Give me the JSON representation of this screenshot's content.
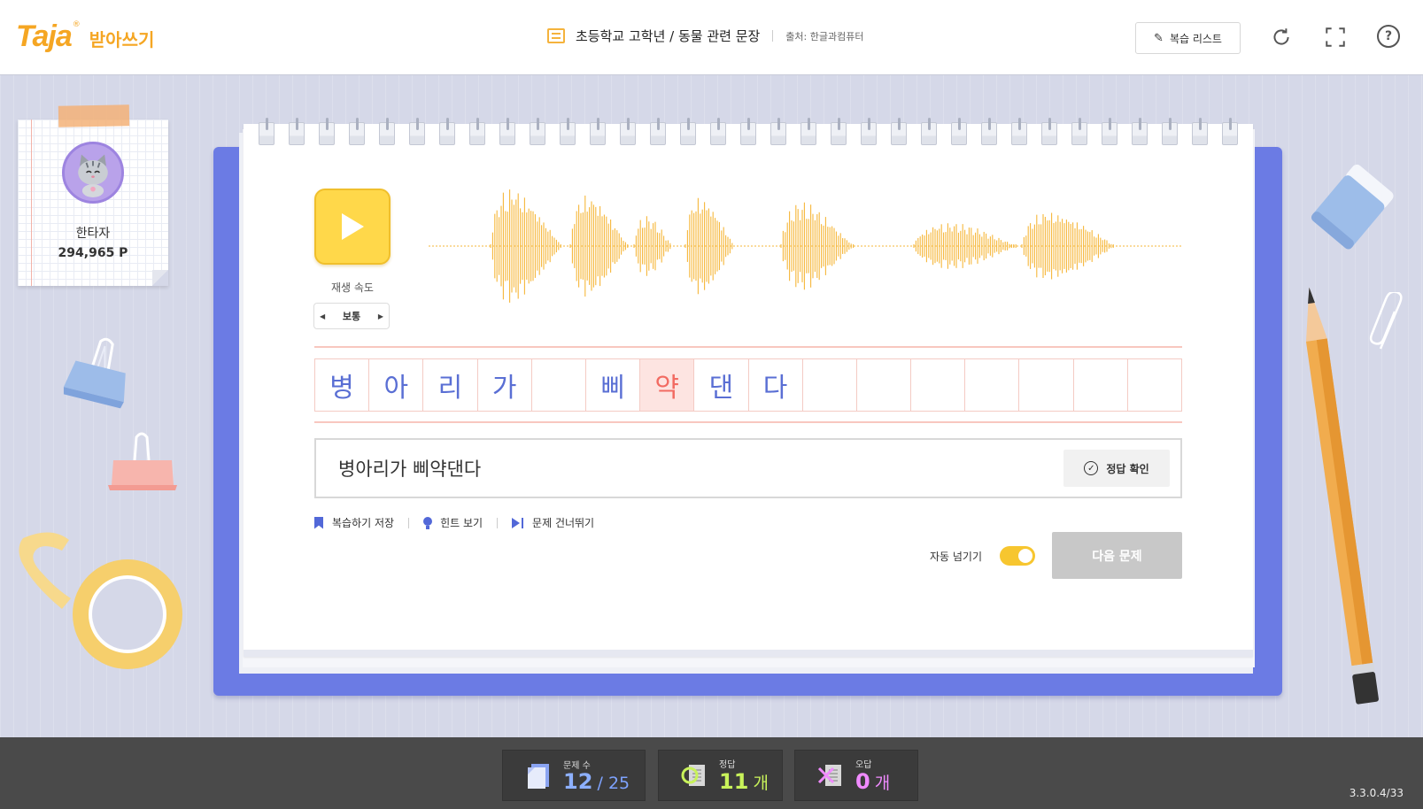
{
  "header": {
    "logo_text": "Taja",
    "logo_reg": "®",
    "logo_subtitle": "받아쓰기",
    "course_title": "초등학교 고학년 / 동물 관련 문장",
    "source": "출처: 한글과컴퓨터",
    "review_list_label": "복습 리스트",
    "help_symbol": "?"
  },
  "profile": {
    "name": "한타자",
    "points": "294,965 P"
  },
  "player": {
    "speed_label": "재생 속도",
    "speed_value": "보통",
    "speed_prev": "◀",
    "speed_next": "▶"
  },
  "answer_cells": [
    "병",
    "아",
    "리",
    "가",
    "",
    "삐",
    "약",
    "댄",
    "다",
    "",
    "",
    "",
    "",
    "",
    "",
    ""
  ],
  "answer_active_index": 6,
  "answer": {
    "typed_text": "병아리가 삐약댄다",
    "check_label": "정답 확인",
    "check_symbol": "✓"
  },
  "tools": {
    "save_review": "복습하기 저장",
    "hint": "힌트 보기",
    "skip": "문제 건너뛰기"
  },
  "controls": {
    "auto_next_label": "자동 넘기기",
    "auto_next_on": true,
    "next_label": "다음 문제"
  },
  "stats": {
    "questions_label": "문제 수",
    "questions_current": "12",
    "questions_total": "/ 25",
    "correct_label": "정답",
    "correct_count": "11",
    "correct_unit": "개",
    "wrong_label": "오답",
    "wrong_count": "0",
    "wrong_unit": "개"
  },
  "version": "3.3.0.4/33",
  "colors": {
    "brand": "#f5a623",
    "accent_blue": "#5a6fd4",
    "active_char": "#f26b62",
    "waveform": "#f5b73a",
    "board": "#6b7be4",
    "toggle_on": "#f7c62f",
    "correct_green": "#c8f25a",
    "wrong_pink": "#f08bff"
  },
  "icons": {
    "crumb": "list-icon",
    "review": "edit-icon",
    "refresh": "refresh-icon",
    "fullscreen": "fullscreen-icon",
    "help": "help-icon",
    "play": "play-icon",
    "check": "check-circle-icon",
    "save": "bookmark-icon",
    "hint": "bulb-icon",
    "skip": "skip-icon"
  }
}
